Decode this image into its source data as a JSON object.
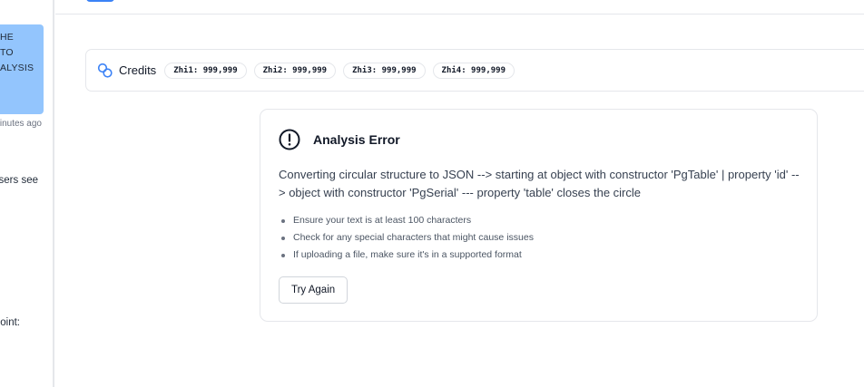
{
  "sidebar": {
    "chat_bubble_lines": [
      "HE",
      "TO",
      "ALYSIS"
    ],
    "chat_time": "minutes ago",
    "fragment_1": "users see",
    "fragment_2": "point:"
  },
  "credits": {
    "label": "Credits",
    "icon": "credits-link-icon",
    "chips": [
      "Zhi1: 999,999",
      "Zhi2: 999,999",
      "Zhi3: 999,999",
      "Zhi4: 999,999"
    ]
  },
  "error": {
    "icon": "alert-circle-icon",
    "title": "Analysis Error",
    "message": "Converting circular structure to JSON --> starting at object with constructor 'PgTable' | property 'id' --> object with constructor 'PgSerial' --- property 'table' closes the circle",
    "tips": [
      "Ensure your text is at least 100 characters",
      "Check for any special characters that might cause issues",
      "If uploading a file, make sure it's in a supported format"
    ],
    "retry_label": "Try Again"
  },
  "colors": {
    "accent": "#3b82f6",
    "chat_bubble": "#93c5fd",
    "border": "#e5e7eb"
  }
}
